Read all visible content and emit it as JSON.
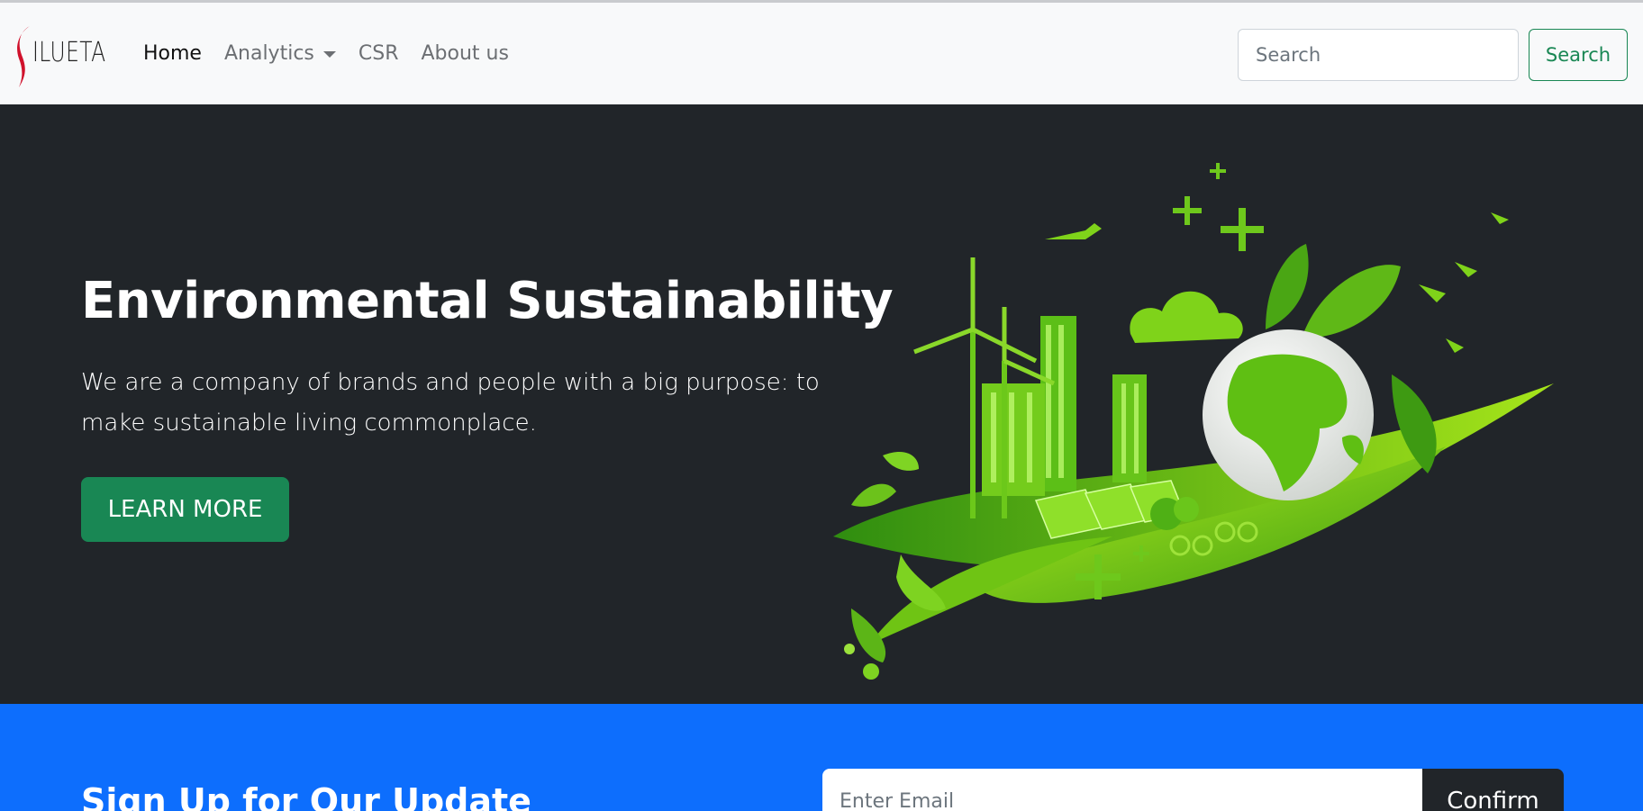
{
  "navbar": {
    "brand": "ILUETA",
    "links": [
      "Home",
      "Analytics",
      "CSR",
      "About us"
    ],
    "search_placeholder": "Search",
    "search_button": "Search"
  },
  "hero": {
    "title": "Environmental Sustainability",
    "lead": "We are a company of brands and people with a big purpose: to make sustainable living commonplace.",
    "button": "LEARN MORE"
  },
  "signup": {
    "title": "Sign Up for Our Update",
    "email_placeholder": "Enter Email",
    "button": "Confirm"
  },
  "colors": {
    "navbar_bg": "#f8f9fa",
    "hero_bg": "#212529",
    "primary_green": "#198754",
    "signup_blue": "#0d6efd",
    "logo_red": "#d0112b"
  },
  "icons": {
    "logo_mark": "red-s-swoosh",
    "hero_illustration": "green-city-globe-illustration",
    "dropdown": "caret-down"
  }
}
